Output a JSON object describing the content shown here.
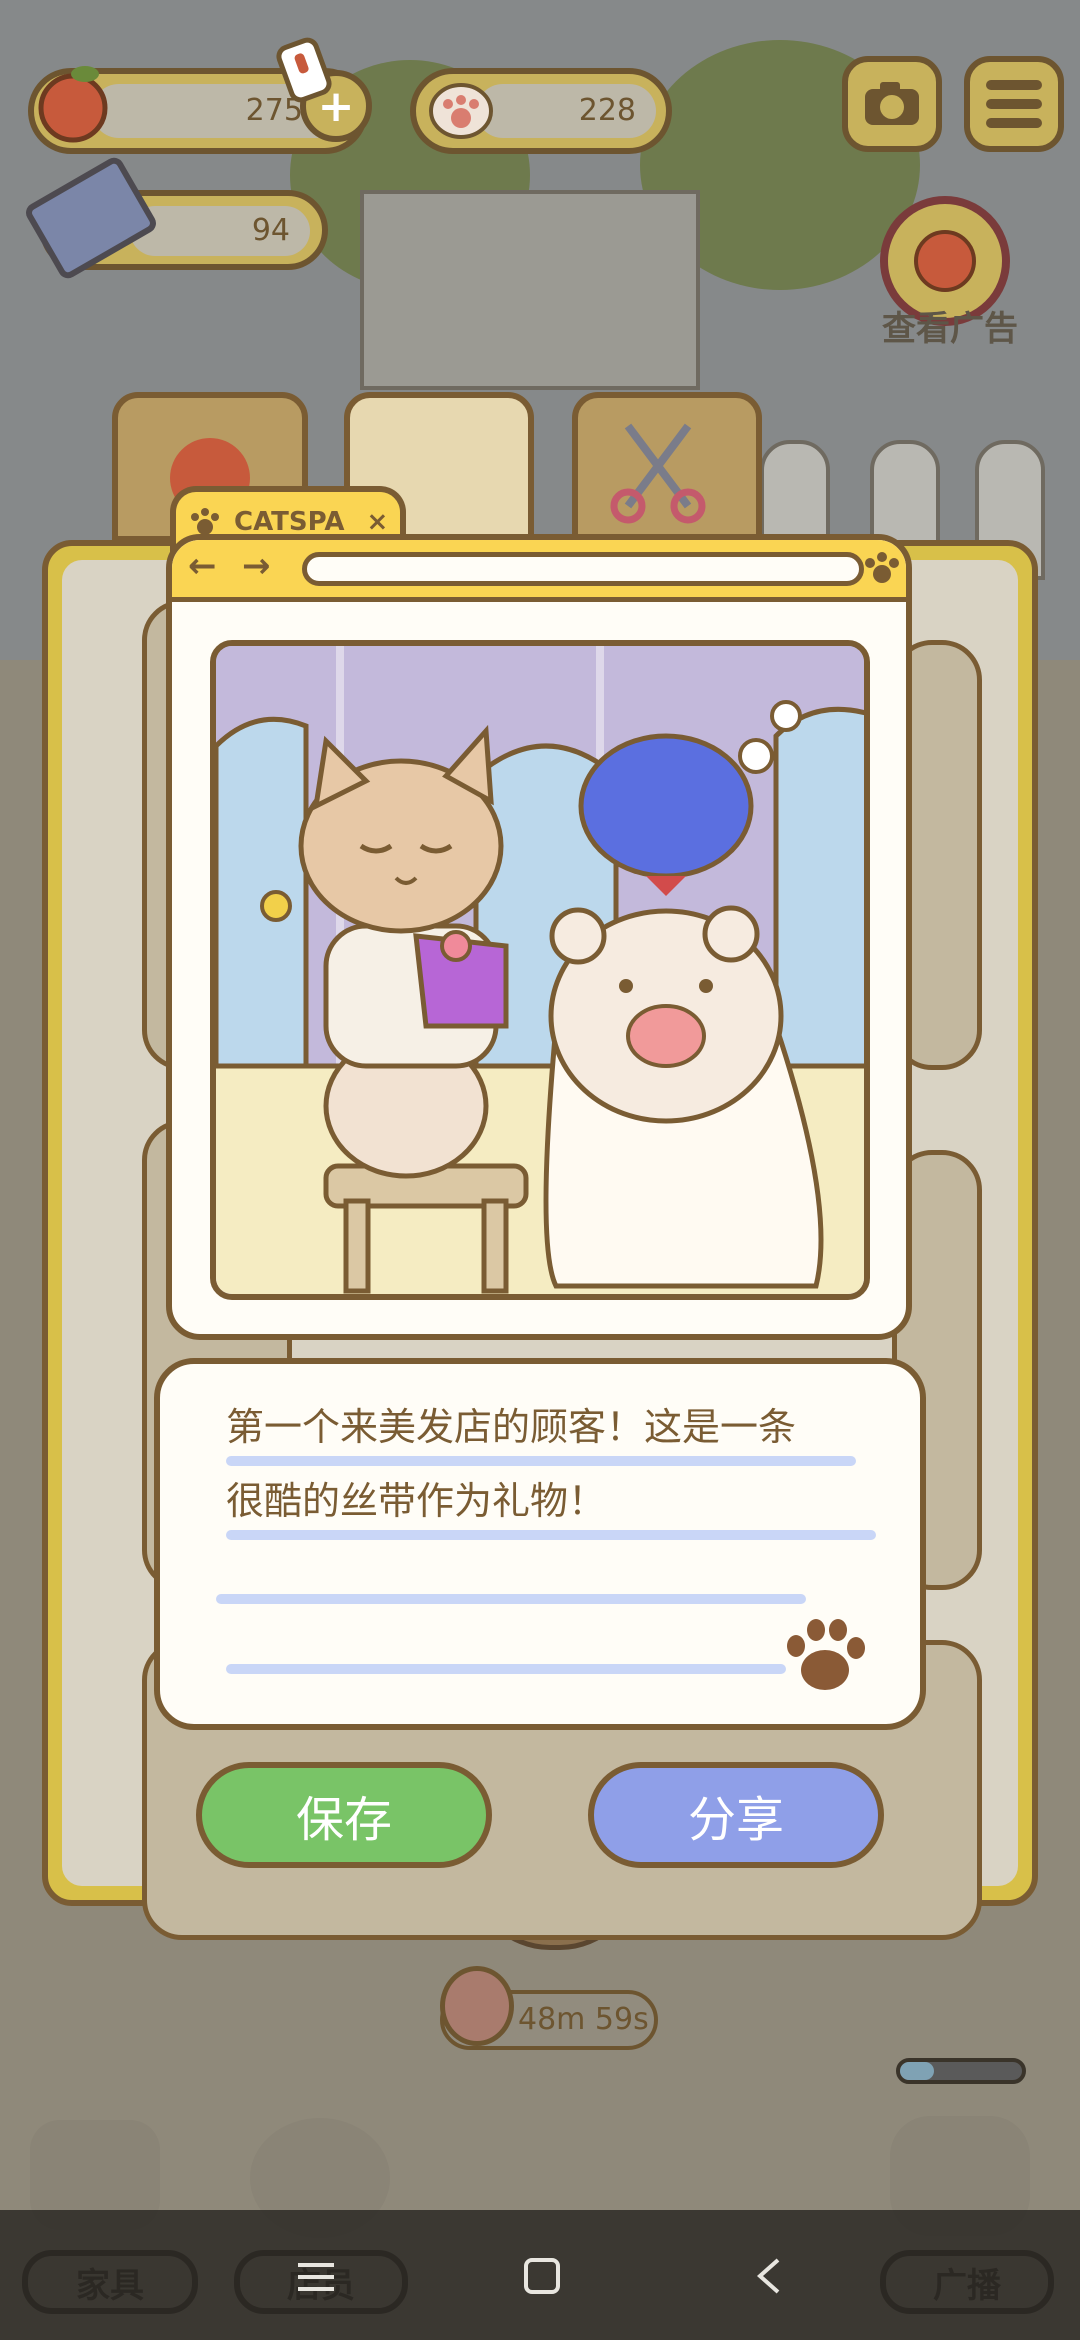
{
  "hud": {
    "apples": "2756",
    "paws": "228",
    "tickets": "94",
    "ad_label": "查看广告"
  },
  "window": {
    "tab_title": "CATSPA",
    "tab_close": "×"
  },
  "message": {
    "line1": "第一个来美发店的顾客！这是一条",
    "line2": "很酷的丝带作为礼物！"
  },
  "buttons": {
    "save": "保存",
    "share": "分享"
  },
  "timer": "48m 59s",
  "bottom": {
    "furniture": "家具",
    "staff": "店员",
    "broadcast": "广播"
  },
  "colors": {
    "save_button": "#79c467",
    "share_button": "#8f9fe8",
    "window_bar": "#fad553",
    "frame": "#d8c049"
  },
  "icons": [
    "apple-icon",
    "paw-icon",
    "ticket-icon",
    "camera-icon",
    "menu-icon",
    "scissors-icon",
    "back-arrow-icon",
    "forward-arrow-icon",
    "stopwatch-icon",
    "megaphone-icon"
  ]
}
